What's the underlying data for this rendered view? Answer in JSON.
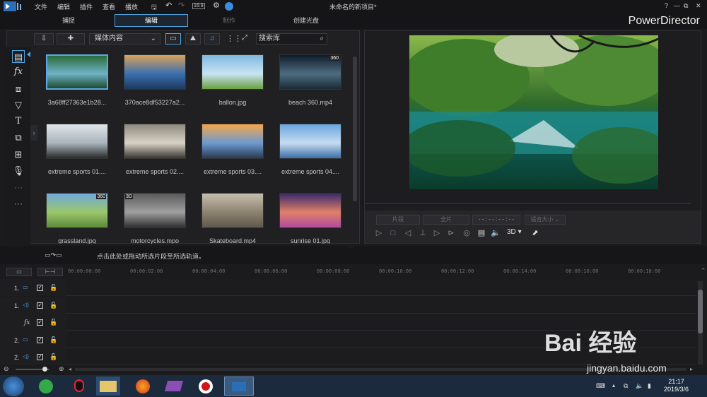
{
  "menu": [
    "文件",
    "编辑",
    "插件",
    "查看",
    "播放"
  ],
  "project_title": "未命名的新项目*",
  "tabs": [
    {
      "label": "捕捉",
      "state": "normal"
    },
    {
      "label": "编辑",
      "state": "active"
    },
    {
      "label": "制作",
      "state": "disabled"
    },
    {
      "label": "创建光盘",
      "state": "normal"
    }
  ],
  "brand": "PowerDirector",
  "window_controls": {
    "help": "?",
    "minimize": "—",
    "restore": "⧉",
    "close": "✕"
  },
  "library": {
    "content_dropdown": "媒体内容",
    "search_placeholder": "搜索库",
    "items": [
      {
        "caption": "3a68ff27363e1b28...",
        "badge": "",
        "selected": true,
        "colors": [
          "#2b6b3a",
          "#6fb3c6",
          "#1d4a2d"
        ]
      },
      {
        "caption": "370ace8df53227a2...",
        "badge": "",
        "selected": false,
        "colors": [
          "#d9a35a",
          "#3a6fb0",
          "#1d3a5e"
        ]
      },
      {
        "caption": "ballon.jpg",
        "badge": "",
        "selected": false,
        "colors": [
          "#7fb8e0",
          "#c9e4f3",
          "#6aa040"
        ]
      },
      {
        "caption": "beach 360.mp4",
        "badge": "360",
        "selected": false,
        "colors": [
          "#0f1c2a",
          "#4d6d80",
          "#1a2a36"
        ]
      },
      {
        "caption": "extreme sports 01....",
        "badge": "",
        "selected": false,
        "colors": [
          "#dfe6ea",
          "#a9b4bb",
          "#2a2a2a"
        ]
      },
      {
        "caption": "extreme sports 02....",
        "badge": "",
        "selected": false,
        "colors": [
          "#8f8a80",
          "#d8d2c6",
          "#3a3630"
        ]
      },
      {
        "caption": "extreme sports 03....",
        "badge": "",
        "selected": false,
        "colors": [
          "#f5a64a",
          "#6d9bd0",
          "#2a3a52"
        ]
      },
      {
        "caption": "extreme sports 04....",
        "badge": "",
        "selected": false,
        "colors": [
          "#6aa7df",
          "#c6dcf0",
          "#3b6ea6"
        ]
      },
      {
        "caption": "grassland.jpg",
        "badge": "360",
        "selected": false,
        "colors": [
          "#6fa9db",
          "#9bc76a",
          "#5b8a3a"
        ]
      },
      {
        "caption": "motorcycles.mpo",
        "badge": "3D",
        "selected": false,
        "colors": [
          "#5a5a5a",
          "#a0a0a0",
          "#2f2f2f"
        ]
      },
      {
        "caption": "Skateboard.mp4",
        "badge": "",
        "selected": false,
        "colors": [
          "#c7bfae",
          "#8c8270",
          "#5f584d"
        ]
      },
      {
        "caption": "sunrise 01.jpg",
        "badge": "",
        "selected": false,
        "colors": [
          "#3a2b6a",
          "#e0806a",
          "#b04a9e"
        ]
      }
    ]
  },
  "preview": {
    "mark_in": "片段",
    "mark_out": "全片",
    "timecode": "- - : - - : - - : - -",
    "fit": "适合大小",
    "mode_3d": "3D"
  },
  "hint": "点击此处或拖动所选片段至所选轨道。",
  "ruler": [
    "00:00:00:00",
    "00:00:02:00",
    "00:00:04:00",
    "00:00:06:00",
    "00:00:08:00",
    "00:00:10:00",
    "00:00:12:00",
    "00:00:14:00",
    "00:00:16:00",
    "00:00:18:00"
  ],
  "tracks": [
    {
      "num": "1.",
      "type": "video"
    },
    {
      "num": "1.",
      "type": "audio"
    },
    {
      "num": "fx",
      "type": "fx"
    },
    {
      "num": "2.",
      "type": "video"
    },
    {
      "num": "2.",
      "type": "audio"
    }
  ],
  "taskbar": {
    "time": "21:17",
    "date": "2019/3/6"
  },
  "watermark": {
    "main": "Bai 经验",
    "sub": "jingyan.baidu.com"
  },
  "colors": {
    "accent": "#4aa3df",
    "background": "#1b1b1d",
    "taskbar": "#1b2a3c"
  }
}
